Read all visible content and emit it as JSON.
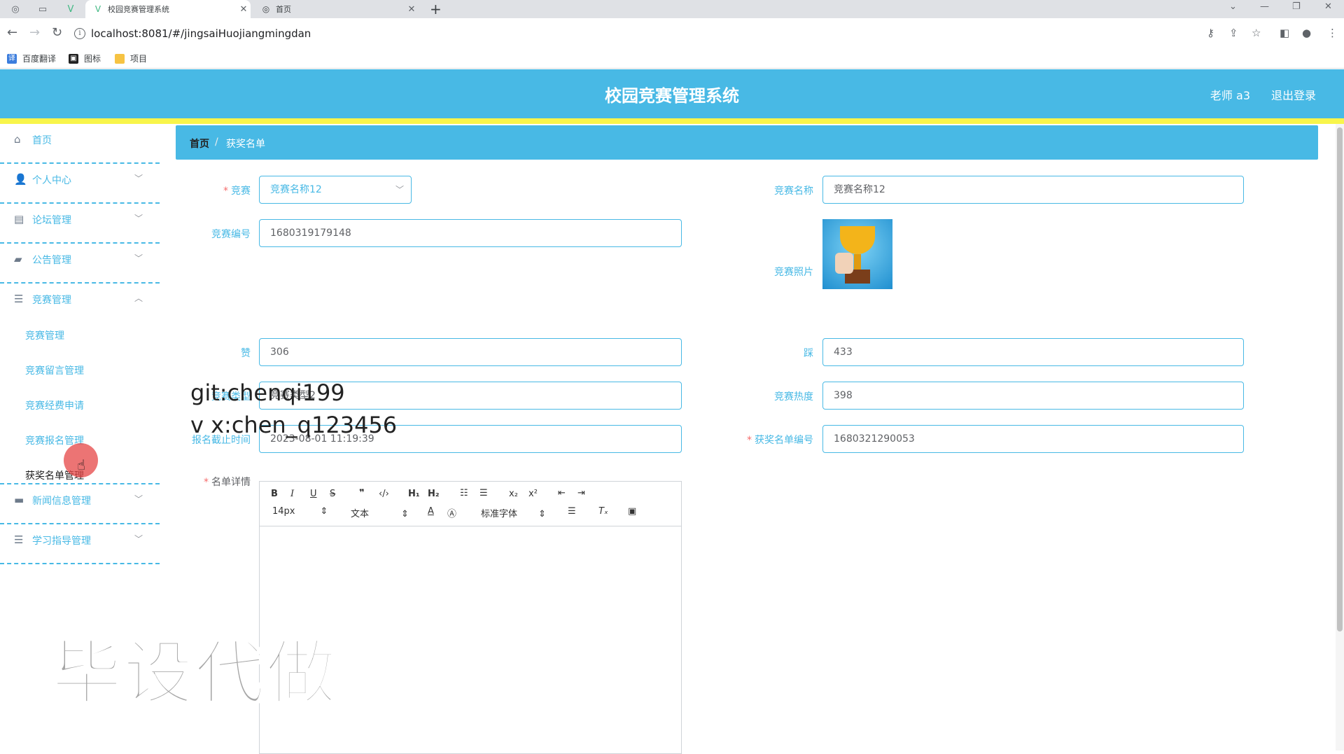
{
  "browser": {
    "tabs": [
      {
        "label": "校园竞赛管理系统",
        "active": true
      },
      {
        "label": "首页",
        "active": false
      }
    ],
    "url": "localhost:8081/#/jingsaiHuojiangmingdan",
    "bookmarks": [
      "百度翻译",
      "图标",
      "项目"
    ]
  },
  "header": {
    "title": "校园竞赛管理系统",
    "user": "老师 a3",
    "logout": "退出登录",
    "bg_color": "#48b9e5",
    "accent_line_color": "#f8f54b"
  },
  "sidebar": {
    "items": [
      {
        "label": "首页",
        "icon": "home-icon"
      },
      {
        "label": "个人中心",
        "icon": "user-icon"
      },
      {
        "label": "论坛管理",
        "icon": "forum-icon"
      },
      {
        "label": "公告管理",
        "icon": "briefcase-icon"
      },
      {
        "label": "竞赛管理",
        "icon": "list-icon",
        "expanded": true
      },
      {
        "label": "新闻信息管理",
        "icon": "chat-icon"
      },
      {
        "label": "学习指导管理",
        "icon": "list-icon"
      }
    ],
    "subitems": [
      "竞赛管理",
      "竞赛留言管理",
      "竞赛经费申请",
      "竞赛报名管理",
      "获奖名单管理"
    ],
    "current_subitem": "获奖名单管理"
  },
  "breadcrumb": {
    "home": "首页",
    "separator": "/",
    "current": "获奖名单"
  },
  "form": {
    "competition_label": "竞赛",
    "competition_value": "竞赛名称12",
    "name_label": "竞赛名称",
    "name_value": "竞赛名称12",
    "number_label": "竞赛编号",
    "number_value": "1680319179148",
    "photo_label": "竞赛照片",
    "likes_label": "赞",
    "likes_value": "306",
    "dislikes_label": "踩",
    "dislikes_value": "433",
    "type_label": "竞赛类型",
    "type_value": "竞赛类型2",
    "heat_label": "竞赛热度",
    "heat_value": "398",
    "deadline_label": "报名截止时间",
    "deadline_value": "2023-08-01 11:19:39",
    "award_number_label": "获奖名单编号",
    "award_number_value": "1680321290053",
    "details_label": "名单详情"
  },
  "editor": {
    "font_size": "14px",
    "text_type": "文本",
    "font_family": "标准字体"
  },
  "overlay": {
    "line1": "git:chenqi199",
    "line2": "v x:chen_q123456",
    "big": "毕设代做"
  }
}
